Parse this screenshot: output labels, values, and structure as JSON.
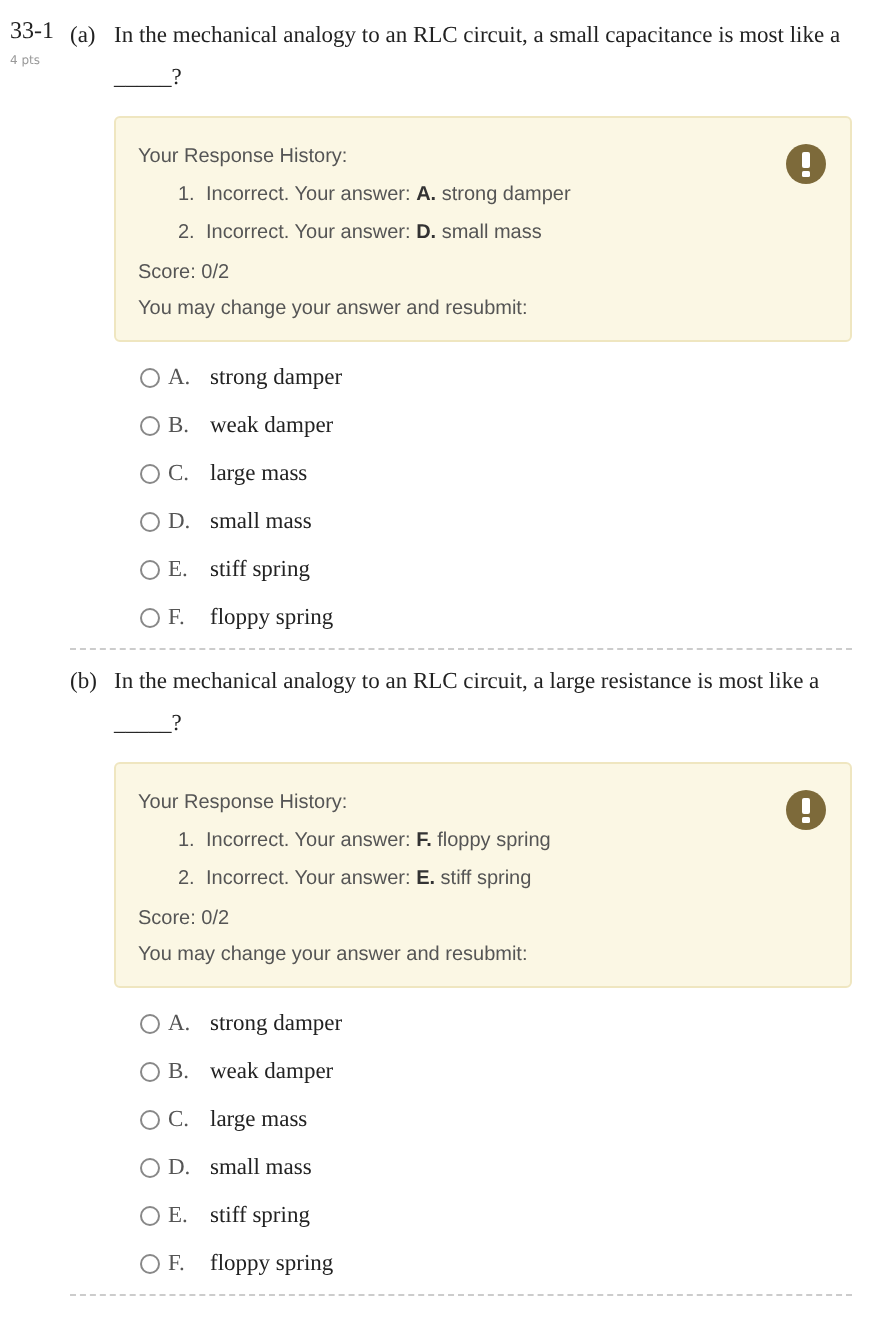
{
  "problem": {
    "number": "33-1",
    "points": "4 pts"
  },
  "parts": [
    {
      "label": "(a)",
      "question": "In the mechanical analogy to an RLC circuit, a small capacitance is most like a _____?",
      "history": {
        "title": "Your Response History:",
        "entries": [
          {
            "number": "1.",
            "text": "Incorrect. Your answer: **A.** strong damper"
          },
          {
            "number": "2.",
            "text": "Incorrect. Your answer: **D.** small mass"
          }
        ],
        "score": "Score: 0/2",
        "note": "You may change your answer and resubmit:"
      },
      "choices": [
        {
          "letter": "A.",
          "text": "strong damper",
          "selected": false
        },
        {
          "letter": "B.",
          "text": "weak damper",
          "selected": false
        },
        {
          "letter": "C.",
          "text": "large mass",
          "selected": false
        },
        {
          "letter": "D.",
          "text": "small mass",
          "selected": false
        },
        {
          "letter": "E.",
          "text": "stiff spring",
          "selected": false
        },
        {
          "letter": "F.",
          "text": "floppy spring",
          "selected": false
        }
      ]
    },
    {
      "label": "(b)",
      "question": "In the mechanical analogy to an RLC circuit, a large resistance is most like a _____?",
      "history": {
        "title": "Your Response History:",
        "entries": [
          {
            "number": "1.",
            "text": "Incorrect. Your answer: **F.** floppy spring"
          },
          {
            "number": "2.",
            "text": "Incorrect. Your answer: **E.** stiff spring"
          }
        ],
        "score": "Score: 0/2",
        "note": "You may change your answer and resubmit:"
      },
      "choices": [
        {
          "letter": "A.",
          "text": "strong damper",
          "selected": false
        },
        {
          "letter": "B.",
          "text": "weak damper",
          "selected": false
        },
        {
          "letter": "C.",
          "text": "large mass",
          "selected": false
        },
        {
          "letter": "D.",
          "text": "small mass",
          "selected": false
        },
        {
          "letter": "E.",
          "text": "stiff spring",
          "selected": false
        },
        {
          "letter": "F.",
          "text": "floppy spring",
          "selected": false
        }
      ]
    }
  ]
}
